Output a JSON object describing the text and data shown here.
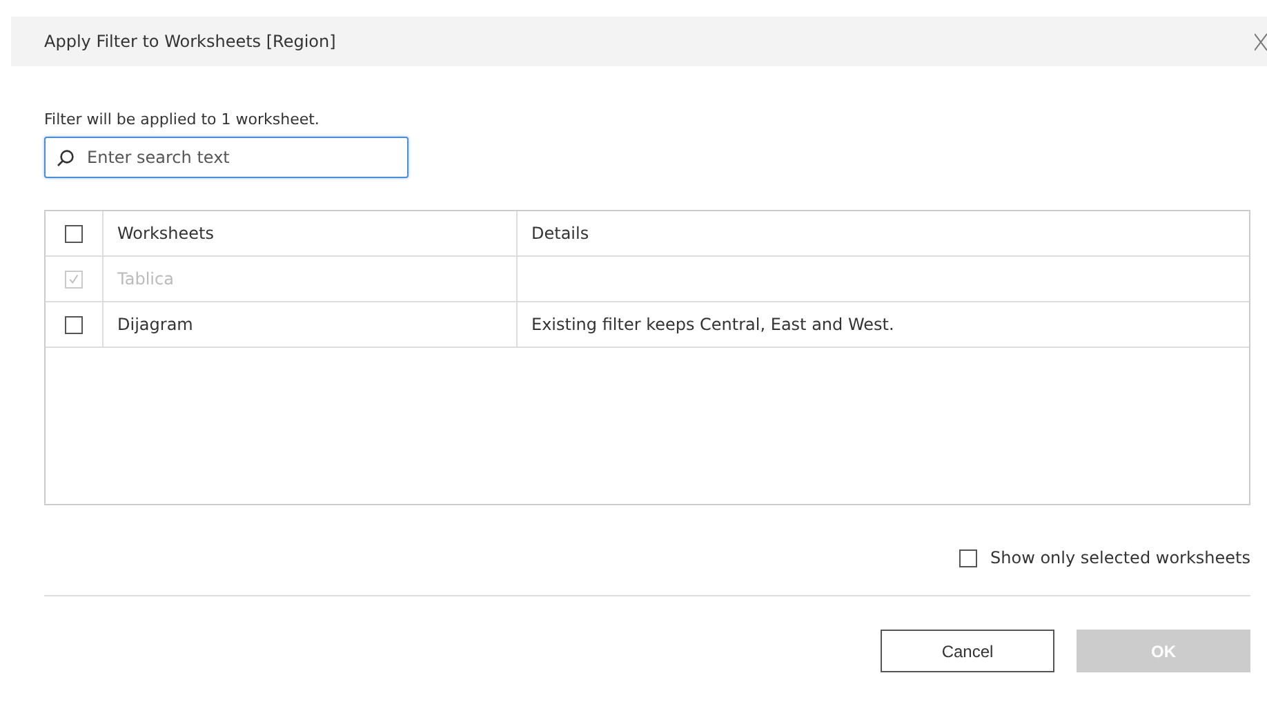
{
  "window": {
    "title": "Apply Filter to Worksheets [Region]"
  },
  "info": "Filter will be applied to 1 worksheet.",
  "search": {
    "placeholder": "Enter search text"
  },
  "table": {
    "select_all": {
      "checked": false
    },
    "columns": [
      "Worksheets",
      "Details"
    ],
    "rows": [
      {
        "name": "Tablica",
        "checked": true,
        "disabled": true
      },
      {
        "name": "Dijagram",
        "details": "Existing filter keeps Central, East and West.",
        "checked": false,
        "disabled": false
      }
    ]
  },
  "show_only_selected": {
    "label": "Show only selected worksheets",
    "checked": false
  },
  "buttons": [
    {
      "label": "Cancel",
      "disabled": false
    },
    {
      "label": "OK",
      "disabled": true
    }
  ]
}
